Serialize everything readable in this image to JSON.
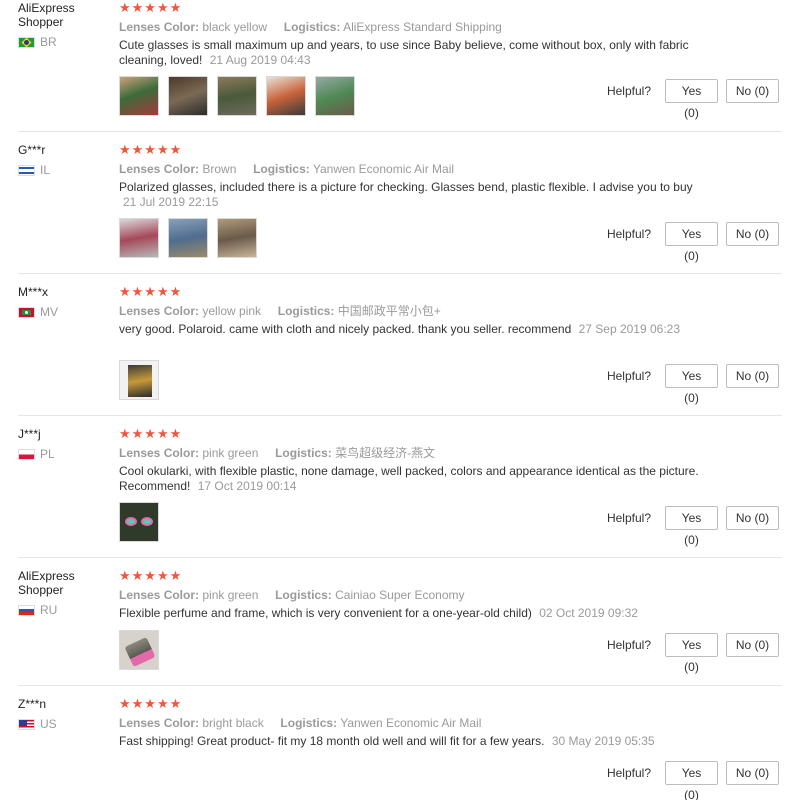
{
  "labels": {
    "lenses_color": "Lenses Color:",
    "logistics": "Logistics:",
    "helpful": "Helpful?",
    "yes": "Yes (0)",
    "no": "No (0)",
    "stars": "★★★★★"
  },
  "reviews": [
    {
      "user": "AliExpress Shopper",
      "country": "BR",
      "lenses_color": "black yellow",
      "logistics": "AliExpress Standard Shipping",
      "text": "Cute glasses is small maximum up and years, to use since Baby believe, come without box, only with fabric cleaning, loved!",
      "date": "21 Aug 2019 04:43",
      "photo_count": 5
    },
    {
      "user": "G***r",
      "country": "IL",
      "lenses_color": "Brown",
      "logistics": "Yanwen Economic Air Mail",
      "text": "Polarized glasses, included there is a picture for checking. Glasses bend, plastic flexible. I advise you to buy",
      "date": "21 Jul 2019 22:15",
      "photo_count": 3
    },
    {
      "user": "M***x",
      "country": "MV",
      "lenses_color": "yellow pink",
      "logistics": "中国邮政平常小包+",
      "text": "very good. Polaroid. came with cloth and nicely packed. thank you seller. recommend",
      "date": "27 Sep 2019 06:23",
      "photo_count": 1
    },
    {
      "user": "J***j",
      "country": "PL",
      "lenses_color": "pink green",
      "logistics": "菜鸟超级经济-燕文",
      "text": "Cool okularki, with flexible plastic, none damage, well packed, colors and appearance identical as the picture. Recommend!",
      "date": "17 Oct 2019 00:14",
      "photo_count": 1
    },
    {
      "user": "AliExpress Shopper",
      "country": "RU",
      "lenses_color": "pink green",
      "logistics": "Cainiao Super Economy",
      "text": "Flexible perfume and frame, which is very convenient for a one-year-old child)",
      "date": "02 Oct 2019 09:32",
      "photo_count": 1
    },
    {
      "user": "Z***n",
      "country": "US",
      "lenses_color": "bright black",
      "logistics": "Yanwen Economic Air Mail",
      "text": "Fast shipping! Great product- fit my 18 month old well and will fit for a few years.",
      "date": "30 May 2019 05:35",
      "photo_count": 0
    }
  ],
  "colors": {
    "star": "#f0563c",
    "muted": "#9a9a9a",
    "divider": "#e6e6e6"
  }
}
